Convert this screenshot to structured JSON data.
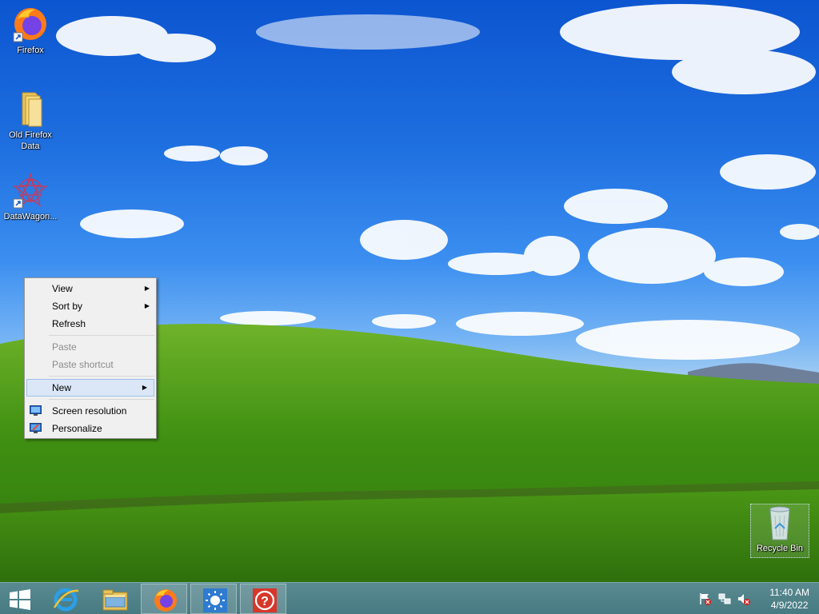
{
  "desktop": {
    "icons": [
      {
        "label": "Firefox",
        "icon": "firefox-icon"
      },
      {
        "label": "Old Firefox\nData",
        "icon": "folder-icon"
      },
      {
        "label": "DataWagon...",
        "icon": "datawagon-icon"
      },
      {
        "label": "Recycle Bin",
        "icon": "recycle-bin-icon"
      }
    ]
  },
  "context_menu": {
    "items": [
      {
        "label": "View"
      },
      {
        "label": "Sort by"
      },
      {
        "label": "Refresh"
      },
      {
        "label": "Paste"
      },
      {
        "label": "Paste shortcut"
      },
      {
        "label": "New"
      },
      {
        "label": "Screen resolution"
      },
      {
        "label": "Personalize"
      }
    ]
  },
  "taskbar": {
    "buttons": [
      "start-button",
      "internet-explorer-icon",
      "file-explorer-icon",
      "firefox-icon",
      "brightness-app-icon",
      "help-app-icon"
    ],
    "tray": {
      "time": "11:40 AM",
      "date": "4/9/2022"
    }
  }
}
